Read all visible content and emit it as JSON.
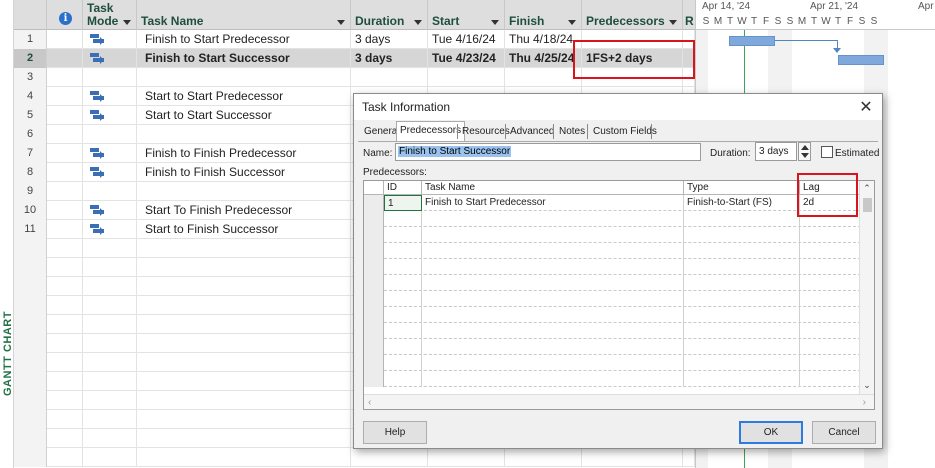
{
  "view": {
    "label": "GANTT CHART"
  },
  "columns": {
    "info": "i",
    "mode_line1": "Task",
    "mode_line2": "Mode",
    "name": "Task Name",
    "duration": "Duration",
    "start": "Start",
    "finish": "Finish",
    "predecessors": "Predecessors",
    "next_col": "R"
  },
  "rows": [
    {
      "id": "1",
      "has_mode": true,
      "name": "Finish to Start Predecessor",
      "duration": "3 days",
      "start": "Tue 4/16/24",
      "finish": "Thu 4/18/24",
      "pred": ""
    },
    {
      "id": "2",
      "has_mode": true,
      "name": "Finish to Start Successor",
      "duration": "3 days",
      "start": "Tue 4/23/24",
      "finish": "Thu 4/25/24",
      "pred": "1FS+2 days"
    },
    {
      "id": "3",
      "has_mode": false,
      "name": "",
      "duration": "",
      "start": "",
      "finish": "",
      "pred": ""
    },
    {
      "id": "4",
      "has_mode": true,
      "name": "Start to Start Predecessor",
      "duration": "",
      "start": "",
      "finish": "",
      "pred": ""
    },
    {
      "id": "5",
      "has_mode": true,
      "name": "Start to Start Successor",
      "duration": "",
      "start": "",
      "finish": "",
      "pred": ""
    },
    {
      "id": "6",
      "has_mode": false,
      "name": "",
      "duration": "",
      "start": "",
      "finish": "",
      "pred": ""
    },
    {
      "id": "7",
      "has_mode": true,
      "name": "Finish to Finish Predecessor",
      "duration": "",
      "start": "",
      "finish": "",
      "pred": ""
    },
    {
      "id": "8",
      "has_mode": true,
      "name": "Finish to Finish Successor",
      "duration": "",
      "start": "",
      "finish": "",
      "pred": ""
    },
    {
      "id": "9",
      "has_mode": false,
      "name": "",
      "duration": "",
      "start": "",
      "finish": "",
      "pred": ""
    },
    {
      "id": "10",
      "has_mode": true,
      "name": "Start To Finish Predecessor",
      "duration": "",
      "start": "",
      "finish": "",
      "pred": ""
    },
    {
      "id": "11",
      "has_mode": true,
      "name": "Start to Finish Successor",
      "duration": "",
      "start": "",
      "finish": "",
      "pred": ""
    }
  ],
  "gantt": {
    "week1": "Apr 14, '24",
    "week2": "Apr 21, '24",
    "week3": "Apr",
    "days": [
      "S",
      "M",
      "T",
      "W",
      "T",
      "F",
      "S",
      "S",
      "M",
      "T",
      "W",
      "T",
      "F",
      "S",
      "S"
    ]
  },
  "dialog": {
    "title": "Task Information",
    "close": "✕",
    "tabs": [
      "General",
      "Predecessors",
      "Resources",
      "Advanced",
      "Notes",
      "Custom Fields"
    ],
    "active_tab": "Predecessors",
    "name_label": "Name:",
    "name_value": "Finish to Start Successor",
    "duration_label": "Duration:",
    "duration_value": "3 days",
    "estimated_label": "Estimated",
    "predecessors_label": "Predecessors:",
    "pred_cols": {
      "id": "ID",
      "task": "Task Name",
      "type": "Type",
      "lag": "Lag"
    },
    "pred_rows": [
      {
        "id": "1",
        "task": "Finish to Start Predecessor",
        "type": "Finish-to-Start (FS)",
        "lag": "2d"
      }
    ],
    "help_label": "Help",
    "ok_label": "OK",
    "cancel_label": "Cancel"
  }
}
